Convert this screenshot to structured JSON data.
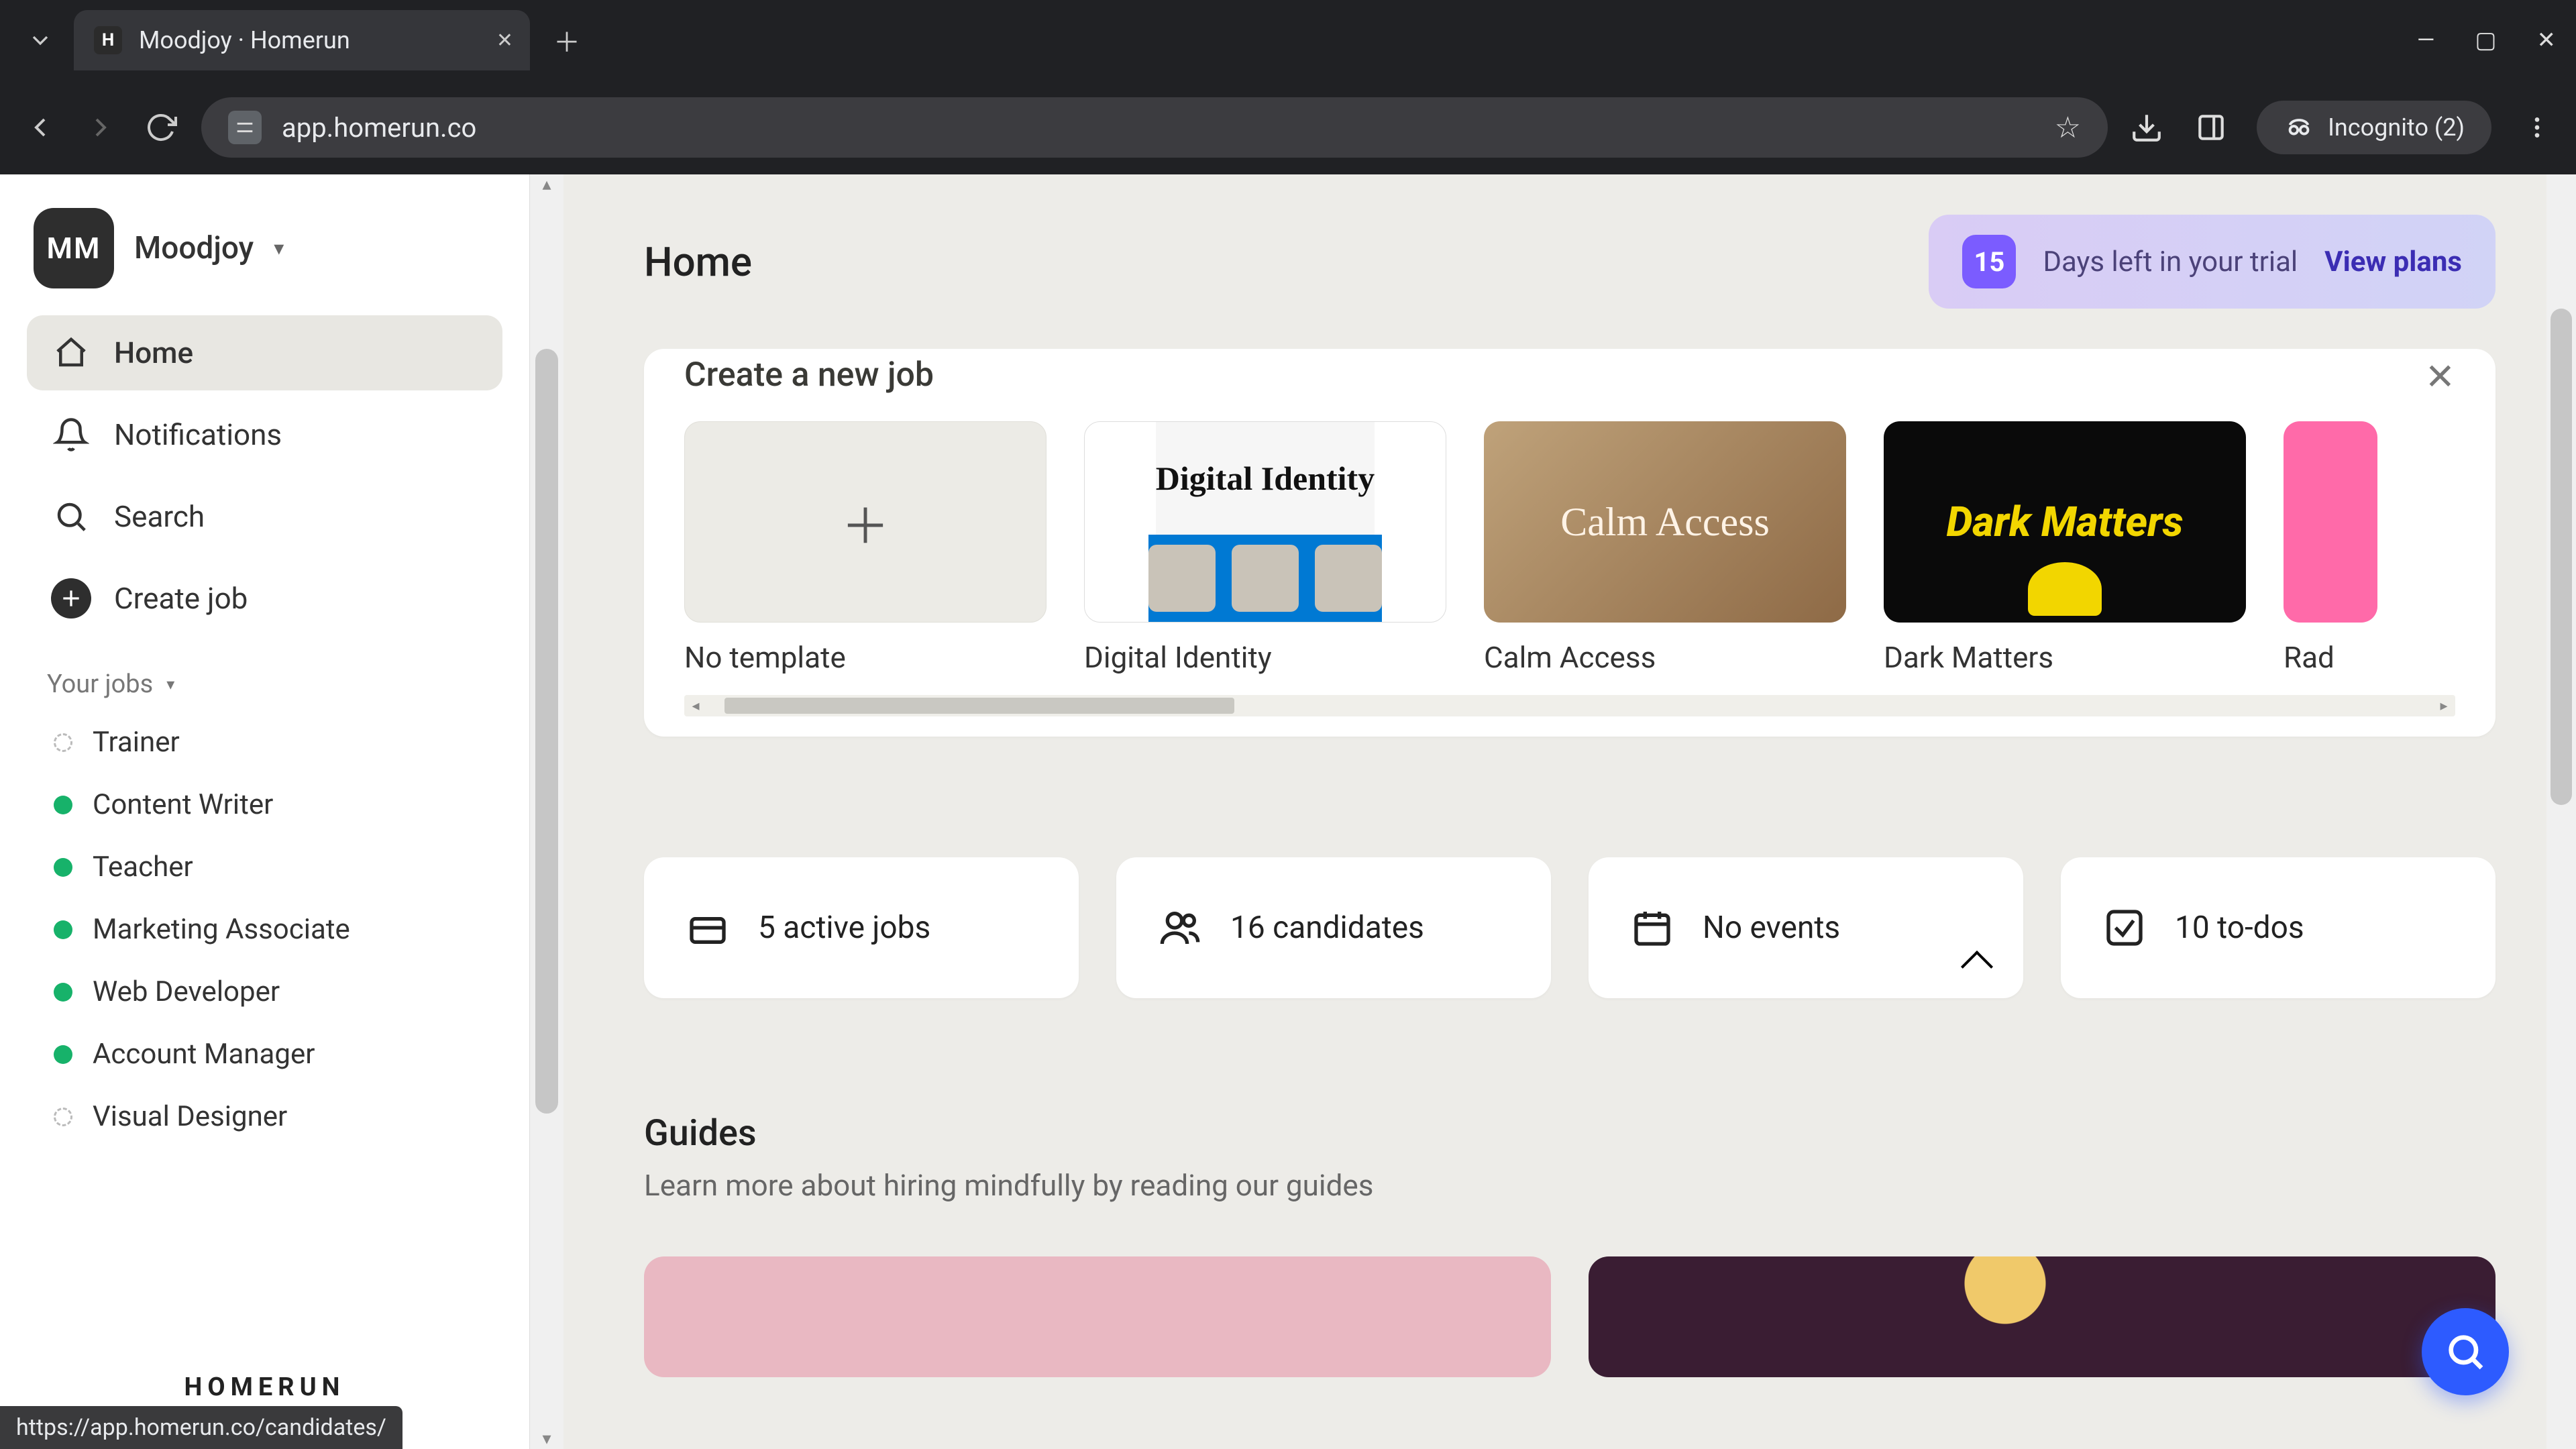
{
  "browser": {
    "tab_title": "Moodjoy · Homerun",
    "url_host": "app.homerun.co",
    "incognito_label": "Incognito (2)",
    "status_url": "https://app.homerun.co/candidates/"
  },
  "workspace": {
    "avatar": "MM",
    "name": "Moodjoy"
  },
  "nav": {
    "home": "Home",
    "notifications": "Notifications",
    "search": "Search",
    "create_job": "Create job"
  },
  "jobs_section": {
    "title": "Your jobs"
  },
  "jobs": [
    {
      "name": "Trainer",
      "status": "draft"
    },
    {
      "name": "Content Writer",
      "status": "active"
    },
    {
      "name": "Teacher",
      "status": "active"
    },
    {
      "name": "Marketing Associate",
      "status": "active"
    },
    {
      "name": "Web Developer",
      "status": "active"
    },
    {
      "name": "Account Manager",
      "status": "active"
    },
    {
      "name": "Visual Designer",
      "status": "draft"
    }
  ],
  "brand": "HOMERUN",
  "page": {
    "title": "Home"
  },
  "trial": {
    "days": "15",
    "text": "Days left in your trial",
    "cta": "View plans"
  },
  "create_panel": {
    "title": "Create a new job",
    "templates": [
      {
        "label": "No template",
        "kind": "blank"
      },
      {
        "label": "Digital Identity",
        "kind": "di",
        "thumb_text": "Digital Identity"
      },
      {
        "label": "Calm Access",
        "kind": "ca",
        "thumb_text": "Calm Access"
      },
      {
        "label": "Dark Matters",
        "kind": "dm",
        "thumb_text": "Dark Matters"
      },
      {
        "label": "Rad",
        "kind": "pink"
      }
    ]
  },
  "stats": {
    "jobs": "5 active jobs",
    "candidates": "16 candidates",
    "events": "No events",
    "todos": "10 to-dos"
  },
  "guides": {
    "title": "Guides",
    "subtitle": "Learn more about hiring mindfully by reading our guides"
  }
}
